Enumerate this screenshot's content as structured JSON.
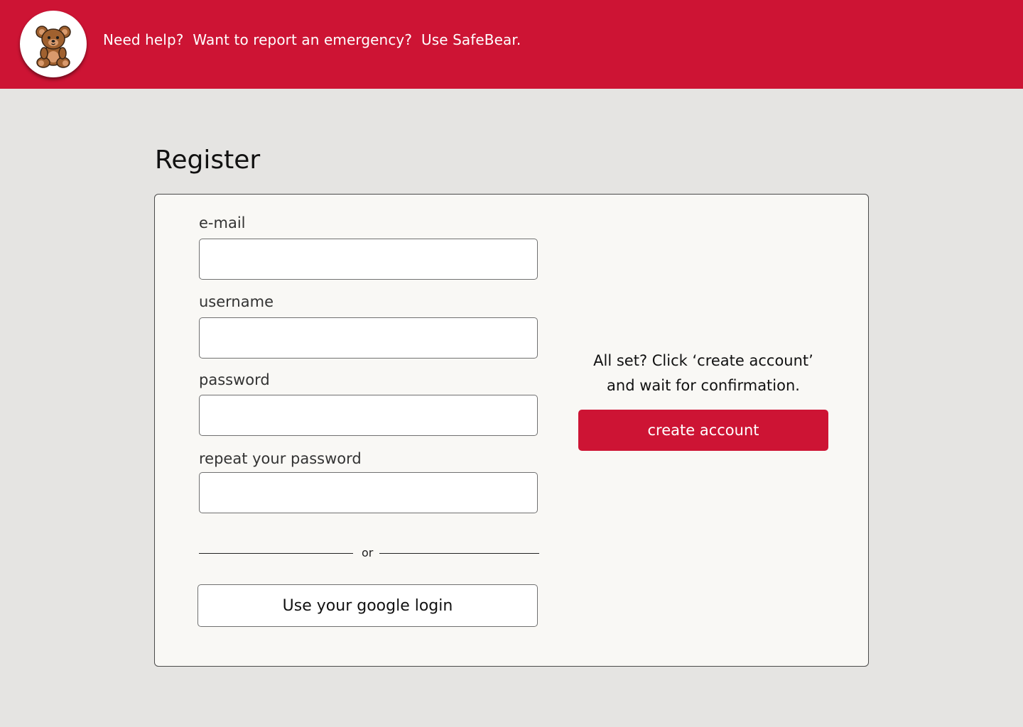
{
  "header": {
    "logo_icon": "teddy-bear-icon",
    "tagline": "Need help?  Want to report an emergency?  Use SafeBear.",
    "background": "#cd1434"
  },
  "page": {
    "title": "Register",
    "background": "#e5e4e2"
  },
  "form": {
    "fields": [
      {
        "label": "e-mail",
        "value": "",
        "placeholder": ""
      },
      {
        "label": "username",
        "value": "",
        "placeholder": ""
      },
      {
        "label": "password",
        "value": "",
        "placeholder": ""
      },
      {
        "label": "repeat your password",
        "value": "",
        "placeholder": ""
      }
    ],
    "divider_label": "or",
    "google_button_label": "Use your google login"
  },
  "confirm": {
    "text_line1": "All set? Click ‘create account’",
    "text_line2": "and wait for confirmation.",
    "create_button_label": "create account",
    "accent": "#cd1434"
  }
}
